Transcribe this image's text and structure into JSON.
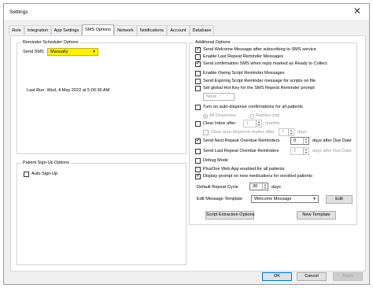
{
  "window": {
    "title": "Settings",
    "close_glyph": "✕"
  },
  "tabs": [
    "Role",
    "Integration",
    "App Settings",
    "SMS Options",
    "Network",
    "Notifications",
    "Account",
    "Database"
  ],
  "reminder_scheduler": {
    "group_label": "Reminder Scheduler Options",
    "send_sms_label": "Send SMS",
    "send_sms_value": "Manually",
    "send_sms_highlight_color": "#fff200",
    "last_run": "Last Run:  Wed, 4 May 2022 at 5:00:30 AM"
  },
  "patient_signup": {
    "group_label": "Patient Sign-Up Options",
    "auto_signup_label": "Auto Sign-Up",
    "auto_signup_checked": false
  },
  "additional_options": {
    "group_label": "Additional Options",
    "send_welcome": {
      "label": "Send Welcome Message after subscribing to SMS service",
      "checked": true
    },
    "enable_last_repeat": {
      "label": "Enable Last Repeat Reminder Messages",
      "checked": false
    },
    "send_confirmation": {
      "label": "Send confirmation SMS when reply marked as Ready to Collect",
      "checked": true
    },
    "enable_owing": {
      "label": "Enable Owing Script Reminder Messages",
      "checked": false
    },
    "send_expiring": {
      "label": "Send Expiring Script Reminder message for scripts on file",
      "checked": false
    },
    "set_hotkey": {
      "label": "Set global Hot Key for the SMS Repeat Reminder prompt",
      "checked": false
    },
    "hotkey_value": "None",
    "auto_dispense": {
      "label": "Turn on auto-dispense confirmations for all patients",
      "checked": false
    },
    "all_dispenses_label": "All Dispenses",
    "replies_only_label": "Replies only",
    "clear_inbox": {
      "label": "Clear Inbox after",
      "value": "1",
      "unit": "months",
      "checked": false
    },
    "clear_replies": {
      "label": "Clear auto-dispense replies after",
      "value": "7",
      "unit": "days",
      "checked": false
    },
    "send_next_overdue": {
      "label": "Send Next Repeat Overdue Reminders",
      "value": "0",
      "suffix": "days after Due Date",
      "checked": true
    },
    "send_last_overdue": {
      "label": "Send Last Repeat Overdue Reminders",
      "value": "3",
      "suffix": "days after Due Date",
      "checked": false
    },
    "debug_mode": {
      "label": "Debug Mode",
      "checked": false
    },
    "plusone_web": {
      "label": "PlusOne Web App enabled for all patients",
      "checked": false
    },
    "display_prompt": {
      "label": "Display prompt on new medications for enrolled patients",
      "checked": true
    },
    "repeat_cycle": {
      "label": "Default Repeat Cycle",
      "value": "30",
      "unit": "days"
    },
    "edit_template": {
      "label": "Edit Message Template",
      "value": "Welcome Message",
      "button": "Edit"
    },
    "script_extraction_button": "Script Extraction Options",
    "new_template_button": "New Template"
  },
  "footer": {
    "ok": "OK",
    "cancel": "Cancel",
    "apply": "Apply"
  }
}
